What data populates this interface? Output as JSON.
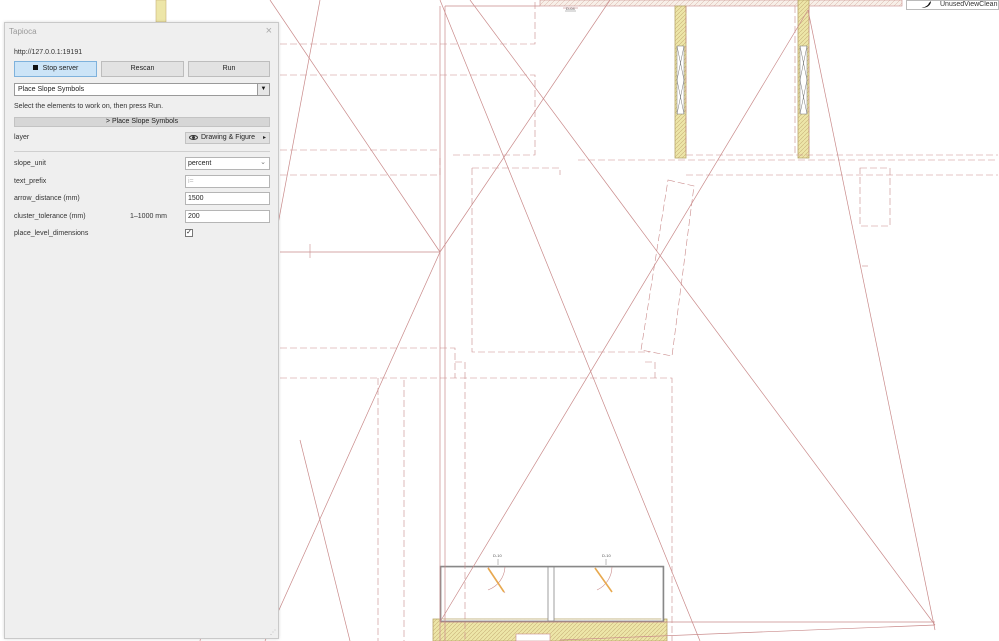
{
  "panel": {
    "title": "Tapioca",
    "close_glyph": "×",
    "server_url": "http://127.0.0.1:19191",
    "buttons": {
      "stop": "Stop server",
      "rescan": "Rescan",
      "run": "Run"
    },
    "command_select": {
      "value": "Place Slope Symbols",
      "arrow_glyph": "▼"
    },
    "instruction": "Select the elements to work on, then press Run.",
    "action_header": "> Place Slope Symbols",
    "layer": {
      "label": "layer",
      "value": "Drawing & Figure",
      "chevron": "▸"
    },
    "params": {
      "slope_unit": {
        "label": "slope_unit",
        "value": "percent",
        "dropdown_glyph": "⌄"
      },
      "text_prefix": {
        "label": "text_prefix",
        "placeholder": "i="
      },
      "arrow_distance": {
        "label": "arrow_distance (mm)",
        "value": "1500"
      },
      "cluster_tolerance": {
        "label": "cluster_tolerance (mm)",
        "range": "1–1000 mm",
        "value": "200"
      },
      "place_level_dimensions": {
        "label": "place_level_dimensions",
        "checked": true,
        "check_glyph": "✓"
      }
    },
    "resize_glyph": "⋰"
  },
  "drawing": {
    "top_tag": "D-04",
    "door_tags": [
      "D-10",
      "D-10"
    ]
  },
  "notification": {
    "text": "UnusedViewClean"
  },
  "colors": {
    "line": "#c98a8a",
    "wall_fill": "#ede6a8",
    "panel_bg": "#efefef",
    "active_button": "#cce4f7"
  },
  "icons": [
    "stop-icon",
    "eye-icon",
    "chevron-right-icon",
    "dropdown-icon",
    "checkbox-icon",
    "close-icon",
    "resize-grip-icon"
  ]
}
